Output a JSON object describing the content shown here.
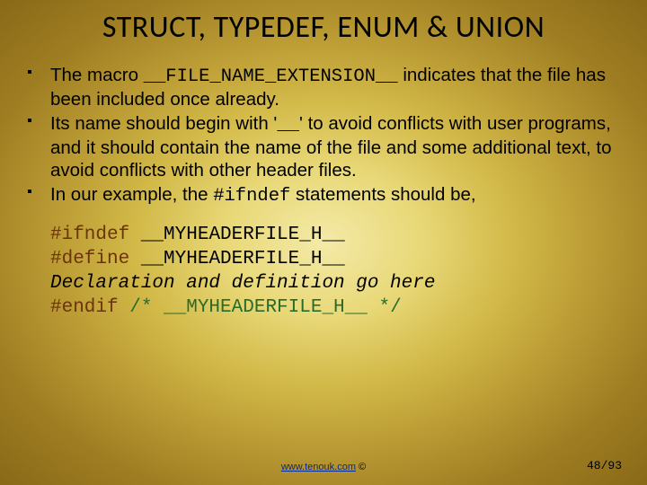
{
  "title": "STRUCT, TYPEDEF, ENUM & UNION",
  "bullets": [
    {
      "pre": "The macro ",
      "code": "__FILE_NAME_EXTENSION__",
      "post": " indicates that the file has been included once already."
    },
    {
      "pre": "Its name should begin with '",
      "code": "__",
      "post": "' to avoid conflicts with user programs, and it should contain the name of the file and some additional text, to avoid conflicts with other header files."
    },
    {
      "pre": "In our example, the ",
      "code": "#ifndef",
      "post": " statements should be,"
    }
  ],
  "code": {
    "l1a": "#ifndef ",
    "l1b": "__MYHEADERFILE_H__",
    "l2a": "#define ",
    "l2b": "__MYHEADERFILE_H__",
    "blank1": " ",
    "decl": "Declaration and definition go here",
    "blank2": " ",
    "l3a": "#endif ",
    "l3b": "/* __MYHEADERFILE_H__ */"
  },
  "footer": {
    "link": "www.tenouk.com",
    "copyright": " ©",
    "page": "48/93"
  }
}
